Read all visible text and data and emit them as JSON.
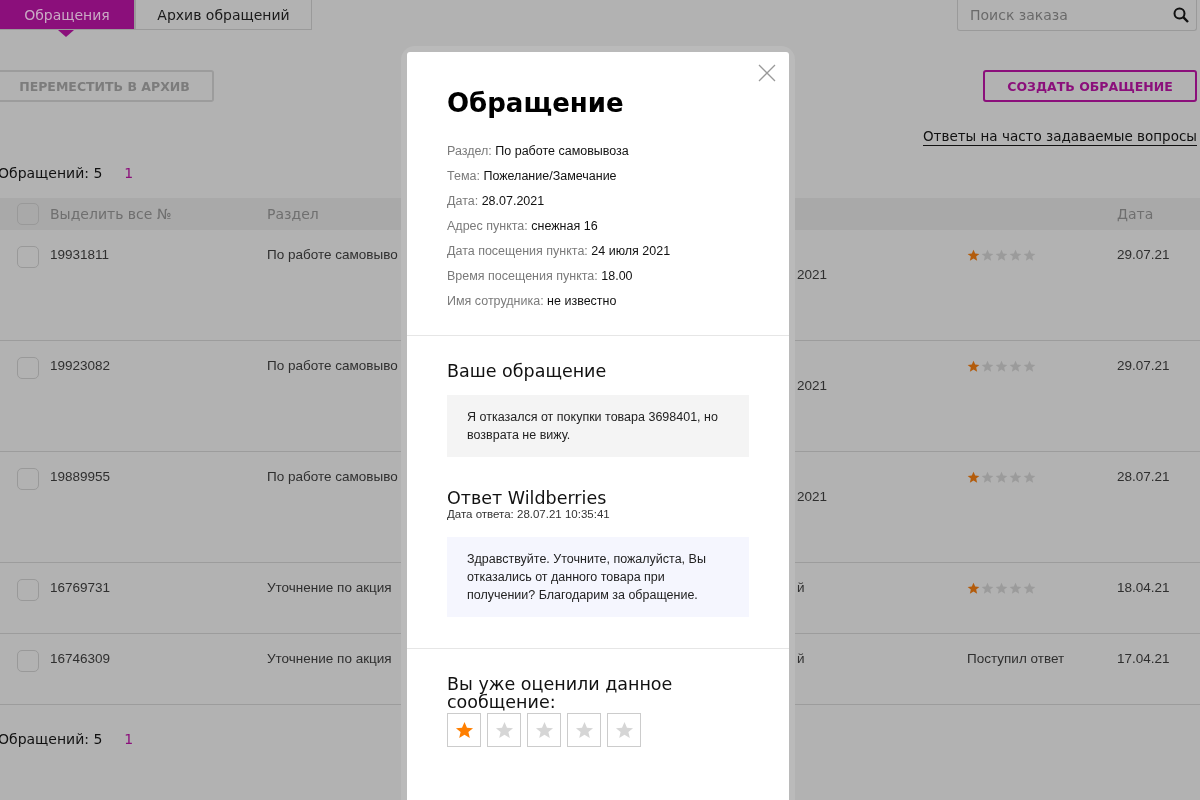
{
  "tabs": [
    {
      "label": "Обращения",
      "selected": true
    },
    {
      "label": "Архив обращений",
      "selected": false
    }
  ],
  "search": {
    "placeholder": "Поиск заказа"
  },
  "archive_button": {
    "label": "ПЕРЕМЕСТИТЬ В АРХИВ",
    "disabled": true
  },
  "create_button": {
    "label": "СОЗДАТЬ ОБРАЩЕНИЕ",
    "disabled": false
  },
  "faq_link": "Ответы на часто задаваемые вопросы",
  "counter_top": {
    "label": "Обращений: 5",
    "page": "1"
  },
  "table": {
    "select_all": {
      "label": "Выделить все №",
      "checked": false
    },
    "columns": [
      "Раздел",
      "Дата"
    ],
    "rows": [
      {
        "checked": false,
        "wrapped": true,
        "number": "19931811",
        "section": "По работе самовыво",
        "column_3": "2021",
        "kind": "rating",
        "stars": 1,
        "date": "29.07.21"
      },
      {
        "checked": false,
        "wrapped": true,
        "number": "19923082",
        "section": "По работе самовыво",
        "column_3": "2021",
        "kind": "rating",
        "stars": 1,
        "date": "29.07.21"
      },
      {
        "checked": false,
        "wrapped": true,
        "number": "19889955",
        "section": "По работе самовыво",
        "column_3": "2021",
        "kind": "rating",
        "stars": 1,
        "date": "28.07.21"
      },
      {
        "checked": false,
        "wrapped": false,
        "number": "16769731",
        "section": "Уточнение по акция",
        "column_3": "й",
        "kind": "rating",
        "stars": 1,
        "date": "18.04.21"
      },
      {
        "checked": false,
        "wrapped": false,
        "number": "16746309",
        "section": "Уточнение по акция",
        "column_3": "й",
        "kind": "status",
        "status": "Поступил ответ",
        "date": "17.04.21"
      }
    ]
  },
  "counter_bottom": {
    "label": "Обращений: 5",
    "page": "1"
  },
  "modal": {
    "title": "Обращение",
    "fields": [
      {
        "label": "Раздел:",
        "value": "По работе самовывоза"
      },
      {
        "label": "Тема:",
        "value": "Пожелание/Замечание"
      },
      {
        "label": "Дата:",
        "value": "28.07.2021"
      },
      {
        "label": "Адрес пункта:",
        "value": "снежная 16"
      },
      {
        "label": "Дата посещения пункта:",
        "value": "24 июля 2021"
      },
      {
        "label": "Время посещения пункта:",
        "value": "18.00"
      },
      {
        "label": "Имя сотрудника:",
        "value": "не известно"
      }
    ],
    "request": {
      "heading": "Ваше обращение",
      "text": "Я отказался от покупки товара 3698401, но возврата не вижу."
    },
    "reply": {
      "heading": "Ответ Wildberries",
      "date": "Дата ответа: 28.07.21 10:35:41",
      "text": "Здравствуйте. Уточните, пожалуйста, Вы отказались от данного товара при получении? Благодарим за обращение."
    },
    "rating": {
      "prompt": "Вы уже оценили данное сообщение:",
      "stars": 1
    }
  }
}
